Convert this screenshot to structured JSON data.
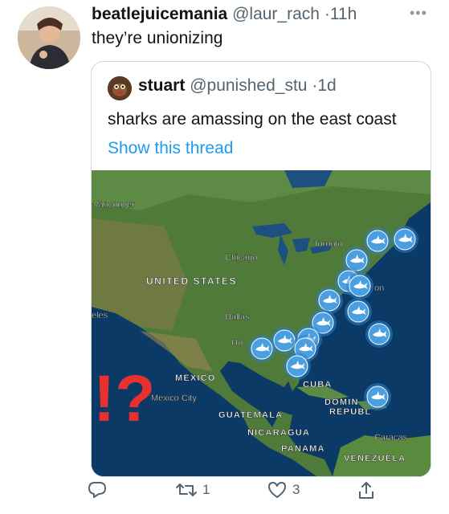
{
  "tweet": {
    "display_name": "beatlejuicemania",
    "handle": "@laur_rach",
    "time": "11h",
    "text": "they’re unionizing",
    "more_icon": "more-dots-icon"
  },
  "quoted_tweet": {
    "display_name": "stuart",
    "handle": "@punished_stu",
    "time": "1d",
    "text": "sharks are amassing on the east coast",
    "link_text": "Show this thread"
  },
  "map": {
    "labels": {
      "vancouver": "Vancouver",
      "toronto": "Toronto",
      "chicago": "Chicago",
      "united_states": "UNITED STATES",
      "boston_fragment": "on",
      "angeles_fragment": "eles",
      "dallas": "Dallas",
      "houston_fragment": "Ho",
      "mexico": "MEXICO",
      "mexico_city": "Mexico City",
      "cuba": "CUBA",
      "dominican_1": "DOMIN",
      "dominican_2": "REPUBL",
      "guatemala": "GUATEMALA",
      "nicaragua": "NICARAGUA",
      "panama": "PANAMA",
      "caracas": "Caracas",
      "venezuela": "VENEZUELA"
    },
    "overlay_text": "!?",
    "colors": {
      "marker": "#4a9fe0",
      "marker_ring": "#2f7fc7",
      "overlay": "#e8312f",
      "ocean": "#0b3a66"
    }
  },
  "actions": {
    "reply": {
      "icon": "reply-icon"
    },
    "retweet": {
      "icon": "retweet-icon",
      "count": "1"
    },
    "like": {
      "icon": "heart-icon",
      "count": "3"
    },
    "share": {
      "icon": "share-icon"
    }
  }
}
